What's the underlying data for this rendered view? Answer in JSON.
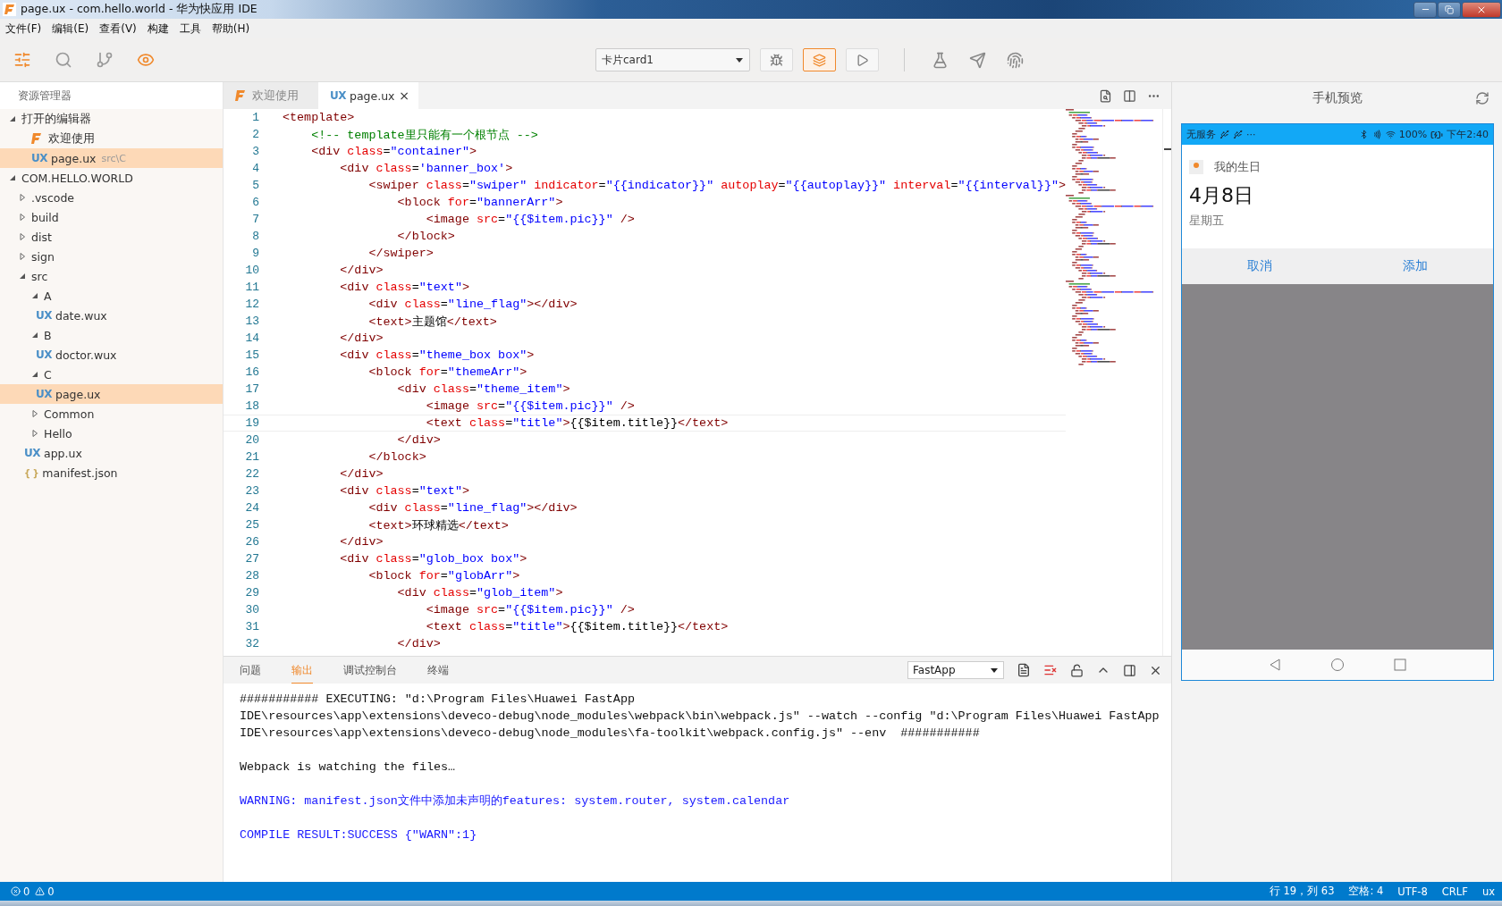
{
  "window": {
    "title": "page.ux - com.hello.world - 华为快应用 IDE"
  },
  "menu": [
    "文件(F)",
    "编辑(E)",
    "查看(V)",
    "构建",
    "工具",
    "帮助(H)"
  ],
  "toolbar": {
    "views": [
      {
        "kind": "explorer",
        "active": true
      },
      {
        "kind": "search",
        "active": false
      },
      {
        "kind": "branch",
        "active": false
      },
      {
        "kind": "preview",
        "active": true
      }
    ],
    "target": {
      "value": "卡片card1"
    },
    "run_buttons": [
      {
        "kind": "debug",
        "active": false
      },
      {
        "kind": "layers",
        "active": true
      },
      {
        "kind": "run",
        "active": false
      }
    ],
    "tools": [
      {
        "kind": "flask"
      },
      {
        "kind": "send"
      },
      {
        "kind": "fingerprint"
      }
    ]
  },
  "sidebar": {
    "title": "资源管理器",
    "sections": [
      {
        "label": "打开的编辑器",
        "expanded": true,
        "children": [
          {
            "kind": "welcome",
            "label": "欢迎使用",
            "selected": false
          },
          {
            "kind": "ux",
            "badge": "UX",
            "label": "page.ux",
            "hint": "src\\C",
            "selected": true
          }
        ]
      },
      {
        "label": "COM.HELLO.WORLD",
        "expanded": true,
        "children": [
          {
            "kind": "folder",
            "label": ".vscode",
            "expanded": false,
            "selected": false
          },
          {
            "kind": "folder",
            "label": "build",
            "expanded": false,
            "selected": false
          },
          {
            "kind": "folder",
            "label": "dist",
            "expanded": false,
            "selected": false
          },
          {
            "kind": "folder",
            "label": "sign",
            "expanded": false,
            "selected": false
          },
          {
            "kind": "folder",
            "label": "src",
            "expanded": true,
            "selected": false,
            "children": [
              {
                "kind": "folder",
                "label": "A",
                "expanded": true,
                "selected": false,
                "children": [
                  {
                    "kind": "ux",
                    "badge": "UX",
                    "label": "date.wux",
                    "selected": false
                  }
                ]
              },
              {
                "kind": "folder",
                "label": "B",
                "expanded": true,
                "selected": false,
                "children": [
                  {
                    "kind": "ux",
                    "badge": "UX",
                    "label": "doctor.wux",
                    "selected": false
                  }
                ]
              },
              {
                "kind": "folder",
                "label": "C",
                "expanded": true,
                "selected": false,
                "children": [
                  {
                    "kind": "ux",
                    "badge": "UX",
                    "label": "page.ux",
                    "selected": true
                  }
                ]
              },
              {
                "kind": "folder",
                "label": "Common",
                "expanded": false,
                "selected": false
              },
              {
                "kind": "folder",
                "label": "Hello",
                "expanded": false,
                "selected": false
              }
            ]
          },
          {
            "kind": "ux",
            "badge": "UX",
            "label": "app.ux",
            "selected": false
          },
          {
            "kind": "json",
            "badge": "{ }",
            "label": "manifest.json",
            "selected": false
          }
        ]
      }
    ]
  },
  "editor": {
    "tabs": [
      {
        "kind": "welcome",
        "label": "欢迎使用",
        "selected": false
      },
      {
        "kind": "ux",
        "badge": "UX",
        "label": "page.ux",
        "close": "×",
        "selected": true
      }
    ],
    "lines": [
      {
        "n": "1",
        "current": false,
        "tokens": [
          {
            "kind": "tag",
            "text": "<template>"
          }
        ]
      },
      {
        "n": "2",
        "current": false,
        "tokens": [
          {
            "kind": "cmt",
            "text": "    <!-- template里只能有一个根节点 -->"
          }
        ]
      },
      {
        "n": "3",
        "current": false,
        "tokens": [
          {
            "kind": "tag",
            "text": "    <div"
          },
          {
            "kind": "attr",
            "text": " class"
          },
          {
            "kind": "txt",
            "text": "="
          },
          {
            "kind": "val",
            "text": "\"container\""
          },
          {
            "kind": "tag",
            "text": ">"
          }
        ]
      },
      {
        "n": "4",
        "current": false,
        "tokens": [
          {
            "kind": "tag",
            "text": "        <div"
          },
          {
            "kind": "attr",
            "text": " class"
          },
          {
            "kind": "txt",
            "text": "="
          },
          {
            "kind": "val",
            "text": "'banner_box'"
          },
          {
            "kind": "tag",
            "text": ">"
          }
        ]
      },
      {
        "n": "5",
        "current": false,
        "tokens": [
          {
            "kind": "tag",
            "text": "            <swiper"
          },
          {
            "kind": "attr",
            "text": " class"
          },
          {
            "kind": "txt",
            "text": "="
          },
          {
            "kind": "val",
            "text": "\"swiper\""
          },
          {
            "kind": "attr",
            "text": " indicator"
          },
          {
            "kind": "txt",
            "text": "="
          },
          {
            "kind": "val",
            "text": "\"{{indicator}}\""
          },
          {
            "kind": "attr",
            "text": " autoplay"
          },
          {
            "kind": "txt",
            "text": "="
          },
          {
            "kind": "val",
            "text": "\"{{autoplay}}\""
          },
          {
            "kind": "attr",
            "text": " interval"
          },
          {
            "kind": "txt",
            "text": "="
          },
          {
            "kind": "val",
            "text": "\"{{interval}}\""
          },
          {
            "kind": "tag",
            "text": ">"
          }
        ]
      },
      {
        "n": "6",
        "current": false,
        "tokens": [
          {
            "kind": "tag",
            "text": "                <block"
          },
          {
            "kind": "attr",
            "text": " for"
          },
          {
            "kind": "txt",
            "text": "="
          },
          {
            "kind": "val",
            "text": "\"bannerArr\""
          },
          {
            "kind": "tag",
            "text": ">"
          }
        ]
      },
      {
        "n": "7",
        "current": false,
        "tokens": [
          {
            "kind": "tag",
            "text": "                    <image"
          },
          {
            "kind": "attr",
            "text": " src"
          },
          {
            "kind": "txt",
            "text": "="
          },
          {
            "kind": "val",
            "text": "\"{{$item.pic}}\""
          },
          {
            "kind": "tag",
            "text": " />"
          }
        ]
      },
      {
        "n": "8",
        "current": false,
        "tokens": [
          {
            "kind": "tag",
            "text": "                </block>"
          }
        ]
      },
      {
        "n": "9",
        "current": false,
        "tokens": [
          {
            "kind": "tag",
            "text": "            </swiper>"
          }
        ]
      },
      {
        "n": "10",
        "current": false,
        "tokens": [
          {
            "kind": "tag",
            "text": "        </div>"
          }
        ]
      },
      {
        "n": "11",
        "current": false,
        "tokens": [
          {
            "kind": "tag",
            "text": "        <div"
          },
          {
            "kind": "attr",
            "text": " class"
          },
          {
            "kind": "txt",
            "text": "="
          },
          {
            "kind": "val",
            "text": "\"text\""
          },
          {
            "kind": "tag",
            "text": ">"
          }
        ]
      },
      {
        "n": "12",
        "current": false,
        "tokens": [
          {
            "kind": "tag",
            "text": "            <div"
          },
          {
            "kind": "attr",
            "text": " class"
          },
          {
            "kind": "txt",
            "text": "="
          },
          {
            "kind": "val",
            "text": "\"line_flag\""
          },
          {
            "kind": "tag",
            "text": "></div>"
          }
        ]
      },
      {
        "n": "13",
        "current": false,
        "tokens": [
          {
            "kind": "tag",
            "text": "            <text>"
          },
          {
            "kind": "txt",
            "text": "主题馆"
          },
          {
            "kind": "tag",
            "text": "</text>"
          }
        ]
      },
      {
        "n": "14",
        "current": false,
        "tokens": [
          {
            "kind": "tag",
            "text": "        </div>"
          }
        ]
      },
      {
        "n": "15",
        "current": false,
        "tokens": [
          {
            "kind": "tag",
            "text": "        <div"
          },
          {
            "kind": "attr",
            "text": " class"
          },
          {
            "kind": "txt",
            "text": "="
          },
          {
            "kind": "val",
            "text": "\"theme_box box\""
          },
          {
            "kind": "tag",
            "text": ">"
          }
        ]
      },
      {
        "n": "16",
        "current": false,
        "tokens": [
          {
            "kind": "tag",
            "text": "            <block"
          },
          {
            "kind": "attr",
            "text": " for"
          },
          {
            "kind": "txt",
            "text": "="
          },
          {
            "kind": "val",
            "text": "\"themeArr\""
          },
          {
            "kind": "tag",
            "text": ">"
          }
        ]
      },
      {
        "n": "17",
        "current": false,
        "tokens": [
          {
            "kind": "tag",
            "text": "                <div"
          },
          {
            "kind": "attr",
            "text": " class"
          },
          {
            "kind": "txt",
            "text": "="
          },
          {
            "kind": "val",
            "text": "\"theme_item\""
          },
          {
            "kind": "tag",
            "text": ">"
          }
        ]
      },
      {
        "n": "18",
        "current": false,
        "tokens": [
          {
            "kind": "tag",
            "text": "                    <image"
          },
          {
            "kind": "attr",
            "text": " src"
          },
          {
            "kind": "txt",
            "text": "="
          },
          {
            "kind": "val",
            "text": "\"{{$item.pic}}\""
          },
          {
            "kind": "tag",
            "text": " />"
          }
        ]
      },
      {
        "n": "19",
        "current": true,
        "tokens": [
          {
            "kind": "tag",
            "text": "                    <text"
          },
          {
            "kind": "attr",
            "text": " class"
          },
          {
            "kind": "txt",
            "text": "="
          },
          {
            "kind": "val",
            "text": "\"title\""
          },
          {
            "kind": "tag",
            "text": ">"
          },
          {
            "kind": "txt",
            "text": "{{$item.title}}"
          },
          {
            "kind": "tag",
            "text": "</text>"
          }
        ]
      },
      {
        "n": "20",
        "current": false,
        "tokens": [
          {
            "kind": "tag",
            "text": "                </div>"
          }
        ]
      },
      {
        "n": "21",
        "current": false,
        "tokens": [
          {
            "kind": "tag",
            "text": "            </block>"
          }
        ]
      },
      {
        "n": "22",
        "current": false,
        "tokens": [
          {
            "kind": "tag",
            "text": "        </div>"
          }
        ]
      },
      {
        "n": "23",
        "current": false,
        "tokens": [
          {
            "kind": "tag",
            "text": "        <div"
          },
          {
            "kind": "attr",
            "text": " class"
          },
          {
            "kind": "txt",
            "text": "="
          },
          {
            "kind": "val",
            "text": "\"text\""
          },
          {
            "kind": "tag",
            "text": ">"
          }
        ]
      },
      {
        "n": "24",
        "current": false,
        "tokens": [
          {
            "kind": "tag",
            "text": "            <div"
          },
          {
            "kind": "attr",
            "text": " class"
          },
          {
            "kind": "txt",
            "text": "="
          },
          {
            "kind": "val",
            "text": "\"line_flag\""
          },
          {
            "kind": "tag",
            "text": "></div>"
          }
        ]
      },
      {
        "n": "25",
        "current": false,
        "tokens": [
          {
            "kind": "tag",
            "text": "            <text>"
          },
          {
            "kind": "txt",
            "text": "环球精选"
          },
          {
            "kind": "tag",
            "text": "</text>"
          }
        ]
      },
      {
        "n": "26",
        "current": false,
        "tokens": [
          {
            "kind": "tag",
            "text": "        </div>"
          }
        ]
      },
      {
        "n": "27",
        "current": false,
        "tokens": [
          {
            "kind": "tag",
            "text": "        <div"
          },
          {
            "kind": "attr",
            "text": " class"
          },
          {
            "kind": "txt",
            "text": "="
          },
          {
            "kind": "val",
            "text": "\"glob_box box\""
          },
          {
            "kind": "tag",
            "text": ">"
          }
        ]
      },
      {
        "n": "28",
        "current": false,
        "tokens": [
          {
            "kind": "tag",
            "text": "            <block"
          },
          {
            "kind": "attr",
            "text": " for"
          },
          {
            "kind": "txt",
            "text": "="
          },
          {
            "kind": "val",
            "text": "\"globArr\""
          },
          {
            "kind": "tag",
            "text": ">"
          }
        ]
      },
      {
        "n": "29",
        "current": false,
        "tokens": [
          {
            "kind": "tag",
            "text": "                <div"
          },
          {
            "kind": "attr",
            "text": " class"
          },
          {
            "kind": "txt",
            "text": "="
          },
          {
            "kind": "val",
            "text": "\"glob_item\""
          },
          {
            "kind": "tag",
            "text": ">"
          }
        ]
      },
      {
        "n": "30",
        "current": false,
        "tokens": [
          {
            "kind": "tag",
            "text": "                    <image"
          },
          {
            "kind": "attr",
            "text": " src"
          },
          {
            "kind": "txt",
            "text": "="
          },
          {
            "kind": "val",
            "text": "\"{{$item.pic}}\""
          },
          {
            "kind": "tag",
            "text": " />"
          }
        ]
      },
      {
        "n": "31",
        "current": false,
        "tokens": [
          {
            "kind": "tag",
            "text": "                    <text"
          },
          {
            "kind": "attr",
            "text": " class"
          },
          {
            "kind": "txt",
            "text": "="
          },
          {
            "kind": "val",
            "text": "\"title\""
          },
          {
            "kind": "tag",
            "text": ">"
          },
          {
            "kind": "txt",
            "text": "{{$item.title}}"
          },
          {
            "kind": "tag",
            "text": "</text>"
          }
        ]
      },
      {
        "n": "32",
        "current": false,
        "tokens": [
          {
            "kind": "tag",
            "text": "                </div>"
          }
        ]
      }
    ]
  },
  "panel": {
    "tabs": [
      {
        "label": "问题",
        "selected": false
      },
      {
        "label": "输出",
        "selected": true
      },
      {
        "label": "调试控制台",
        "selected": false
      },
      {
        "label": "终端",
        "selected": false
      }
    ],
    "channel": {
      "value": "FastApp"
    },
    "output": [
      {
        "kind": "plain",
        "lines": [
          "########### EXECUTING: \"d:\\Program Files\\Huawei FastApp",
          "IDE\\resources\\app\\extensions\\deveco-debug\\node_modules\\webpack\\bin\\webpack.js\" --watch --config \"d:\\Program Files\\Huawei FastApp",
          "IDE\\resources\\app\\extensions\\deveco-debug\\node_modules\\fa-toolkit\\webpack.config.js\" --env  ###########"
        ]
      },
      {
        "kind": "plain",
        "lines": [
          "Webpack is watching the files…"
        ]
      },
      {
        "kind": "info",
        "lines": [
          "WARNING: manifest.json文件中添加未声明的features: system.router, system.calendar"
        ]
      },
      {
        "kind": "info",
        "lines": [
          "COMPILE RESULT:SUCCESS {\"WARN\":1}"
        ]
      }
    ]
  },
  "preview": {
    "title": "手机预览",
    "phone": {
      "carrier": "无服务",
      "more": "···",
      "battery": "100%",
      "time": "下午2:40",
      "card": {
        "app": "我的生日",
        "date": "4月8日",
        "weekday": "星期五"
      },
      "buttons": [
        "取消",
        "添加"
      ]
    }
  },
  "status_bar": {
    "errors": "0",
    "warnings": "0",
    "items": [
      "行 19，列 63",
      "空格: 4",
      "UTF-8",
      "CRLF",
      "ux"
    ]
  }
}
